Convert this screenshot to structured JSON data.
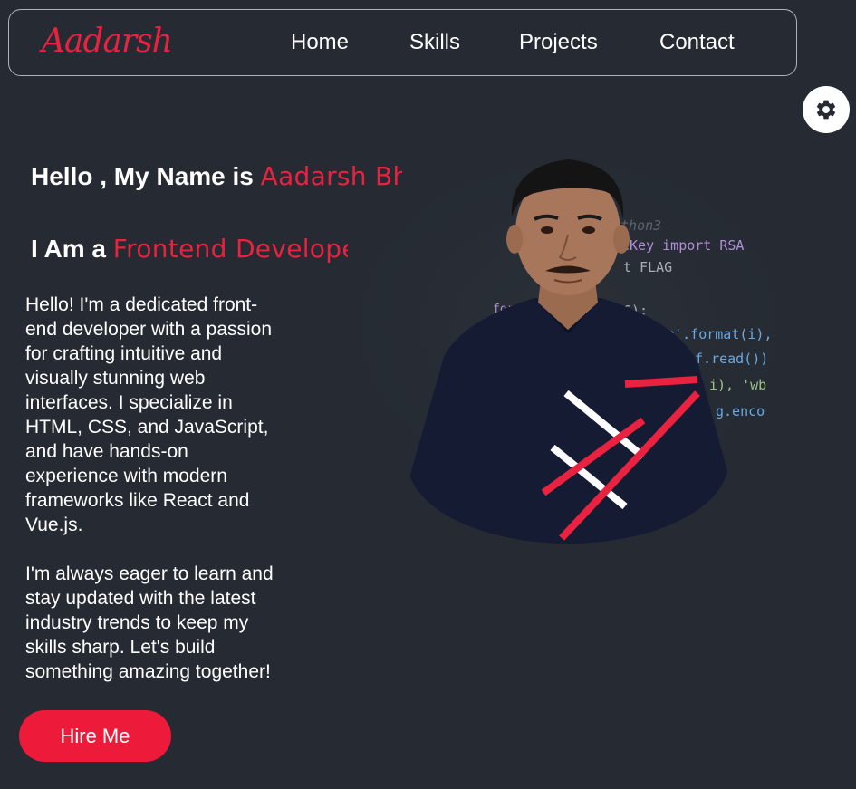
{
  "nav": {
    "logo": "Aadarsh",
    "links": [
      "Home",
      "Skills",
      "Projects",
      "Contact"
    ]
  },
  "settings": {
    "icon": "gear-icon"
  },
  "hero": {
    "greeting_prefix": "Hello , My Name is ",
    "name": "Aadarsh Bh",
    "role_prefix": "I Am a ",
    "role": "Frontend Develope",
    "bio_paragraphs": [
      "Hello! I'm a dedicated front-end developer with a passion for crafting intuitive and visually stunning web interfaces. I specialize in HTML, CSS, and JavaScript, and have hands-on experience with modern frameworks like React and Vue.js.",
      "I'm always eager to learn and stay updated with the latest industry trends to keep my skills sharp. Let's build something amazing together!"
    ],
    "cta_label": "Hire Me"
  },
  "portrait": {
    "code_lines": [
      "ython3",
      "cKey import RSA",
      "t FLAG",
      "for i",
      "6):",
      ".pem'.format(i),",
      "(f.read())",
      "i), 'wb",
      "g.enco"
    ]
  },
  "colors": {
    "background": "#262b33",
    "accent": "#e8223f",
    "button": "#ed1a3a",
    "text": "#ffffff"
  }
}
